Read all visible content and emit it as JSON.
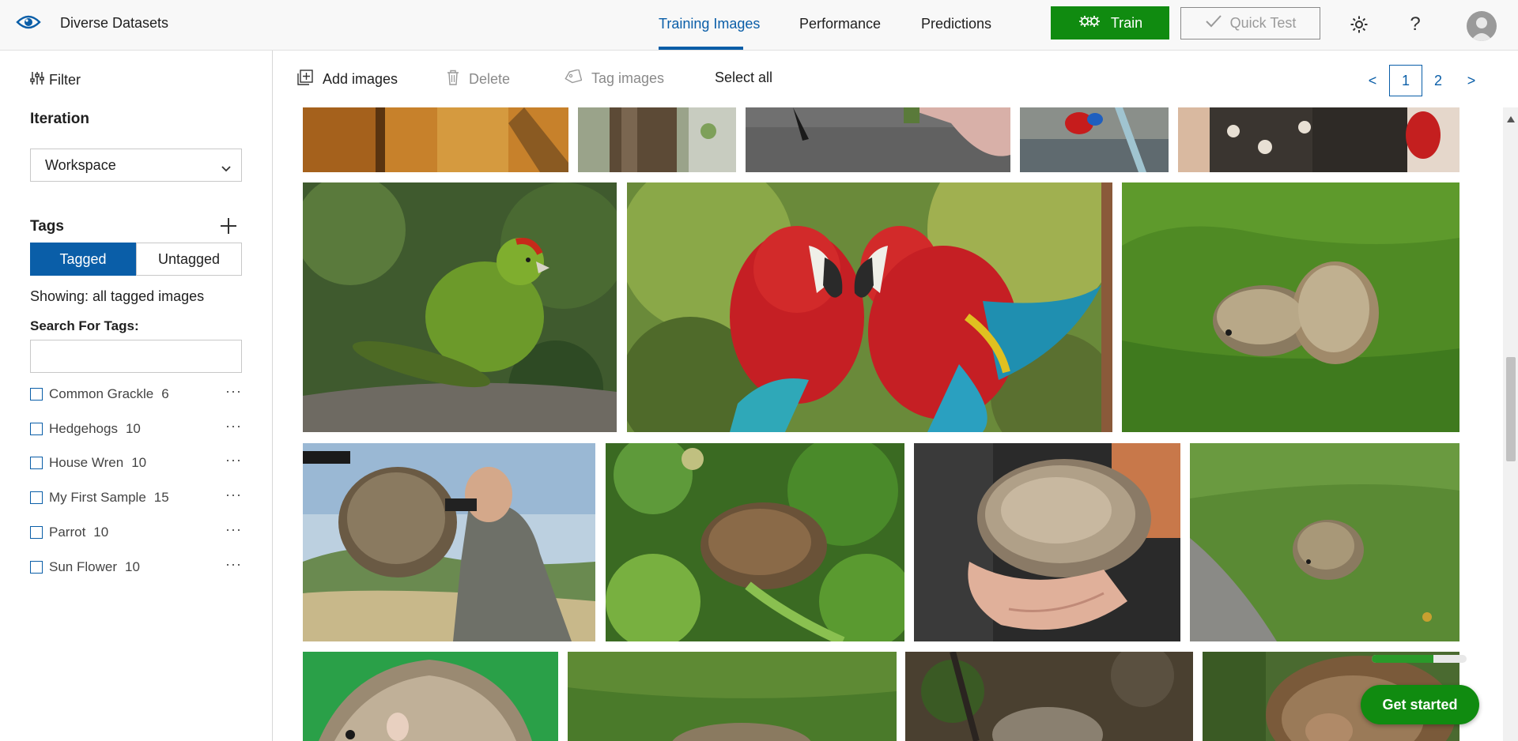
{
  "header": {
    "project_title": "Diverse Datasets",
    "tabs": [
      {
        "label": "Training Images",
        "active": true
      },
      {
        "label": "Performance",
        "active": false
      },
      {
        "label": "Predictions",
        "active": false
      }
    ],
    "train_label": "Train",
    "quick_test_label": "Quick Test",
    "help_glyph": "?",
    "accent_color": "#0a5ea8",
    "train_color": "#108b10"
  },
  "sidebar": {
    "filter_label": "Filter",
    "iteration_title": "Iteration",
    "iteration_value": "Workspace",
    "tags_title": "Tags",
    "tagged_label": "Tagged",
    "untagged_label": "Untagged",
    "showing_text": "Showing: all tagged images",
    "search_label": "Search For Tags:",
    "search_value": "",
    "tags": [
      {
        "name": "Common Grackle",
        "count": "6"
      },
      {
        "name": "Hedgehogs",
        "count": "10"
      },
      {
        "name": "House Wren",
        "count": "10"
      },
      {
        "name": "My First Sample",
        "count": "15"
      },
      {
        "name": "Parrot",
        "count": "10"
      },
      {
        "name": "Sun Flower",
        "count": "10"
      }
    ],
    "more_glyph": "···"
  },
  "toolbar": {
    "add_label": "Add images",
    "delete_label": "Delete",
    "tag_label": "Tag images",
    "select_all_label": "Select all",
    "pager": {
      "prev": "<",
      "pages": [
        "1",
        "2"
      ],
      "current": "1",
      "next": ">"
    }
  },
  "gallery": {
    "images": [
      "wood-crate-photo",
      "tree-trunk-photo",
      "pavement-bird-photo",
      "red-parrot-on-crate-photo",
      "person-with-parrot-photo",
      "green-parrot-photo",
      "scarlet-macaws-photo",
      "hedgehogs-in-grass-photo",
      "man-with-binoculars-hedgehog-photo",
      "hedgehog-in-leaves-photo",
      "hedgehog-in-hand-photo",
      "hedgehog-on-path-photo",
      "hedgehog-on-green-photo",
      "hedgehog-in-grass-photo",
      "hedgehog-in-dirt-photo",
      "hedgehog-closeup-photo"
    ]
  },
  "onboarding": {
    "get_started_label": "Get started",
    "progress": 0.65
  }
}
